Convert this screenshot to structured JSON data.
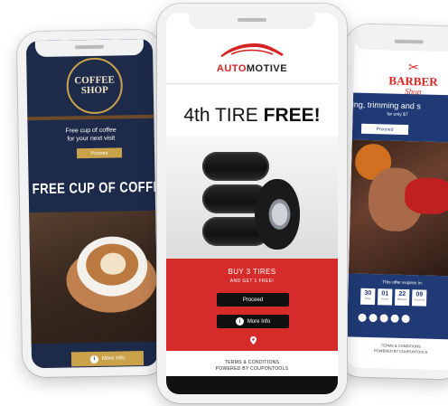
{
  "coffee": {
    "logo_title": "COFFEE SHOP",
    "offer_line1": "Free cup of coffee",
    "offer_line2": "for your next visit",
    "proceed_label": "Proceed",
    "headline": "FREE CUP OF COFFEE",
    "more_info_label": "More Info"
  },
  "automotive": {
    "brand_part1": "AUTO",
    "brand_part2": "MOTIVE",
    "headline_part1": "4th TIRE ",
    "headline_part2": "FREE!",
    "buy_line": "BUY 3 TIRES",
    "get_line": "AND GET 1 FREE!",
    "proceed_label": "Proceed",
    "more_info_label": "More Info",
    "terms_line1": "TERMS & CONDITIONS",
    "terms_line2": "POWERED BY COUPONTOOLS"
  },
  "barber": {
    "logo_line1": "BARBER",
    "logo_line2": "Shop",
    "offer_line1": "hing, trimming and s",
    "offer_line2": "for only $7",
    "proceed_label": "Proceed",
    "expires_label": "This offer expires in:",
    "timer": [
      {
        "value": "30",
        "unit": "Days"
      },
      {
        "value": "01",
        "unit": "Hours"
      },
      {
        "value": "22",
        "unit": "Minutes"
      },
      {
        "value": "09",
        "unit": "Seconds"
      }
    ],
    "terms_line1": "TERMS & CONDITIONS",
    "terms_line2": "POWERED BY COUPONTOOLS"
  },
  "colors": {
    "coffee_navy": "#1d2a4a",
    "coffee_gold": "#c9a24a",
    "auto_red": "#d62b2b",
    "barber_blue": "#1f3a75",
    "barber_red": "#d22222"
  },
  "icons": [
    "info-icon",
    "map-pin-icon",
    "scissors-icon",
    "car-icon",
    "social-icons"
  ]
}
